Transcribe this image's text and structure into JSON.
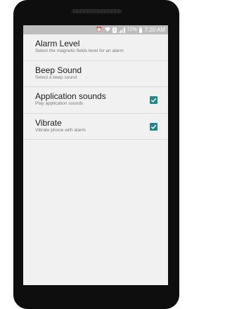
{
  "status_bar": {
    "battery_percent": "72%",
    "time": "7:20 AM",
    "sim_label": "1"
  },
  "settings": [
    {
      "title": "Alarm Level",
      "summary": "Select the magnetic fields level for an alarm"
    },
    {
      "title": "Beep Sound",
      "summary": "Select a beep sound"
    },
    {
      "title": "Application sounds",
      "summary": "Play application sounds",
      "checked": true
    },
    {
      "title": "Vibrate",
      "summary": "Vibrate phone with alarm",
      "checked": true
    }
  ],
  "colors": {
    "accent": "#1e8a85",
    "status_bar": "#bdbdbd",
    "background": "#f1f1f1"
  }
}
